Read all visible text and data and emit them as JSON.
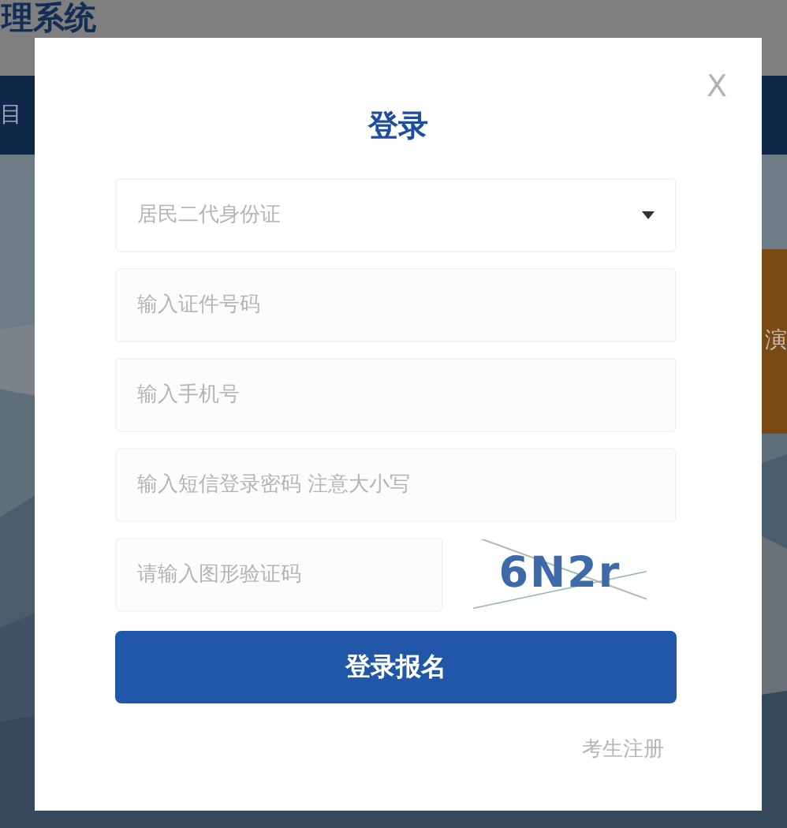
{
  "background": {
    "title": "理系统",
    "nav_item": "目",
    "side_tab": "演"
  },
  "dialog": {
    "close": "X",
    "title": "登录",
    "id_type": {
      "value": "居民二代身份证"
    },
    "fields": [
      {
        "placeholder": "输入证件号码"
      },
      {
        "placeholder": "输入手机号"
      },
      {
        "placeholder": "输入短信登录密码 注意大小写"
      }
    ],
    "captcha_field": {
      "placeholder": "请输入图形验证码"
    },
    "captcha": "6N2r",
    "submit": "登录报名",
    "register_link": "考生注册"
  }
}
